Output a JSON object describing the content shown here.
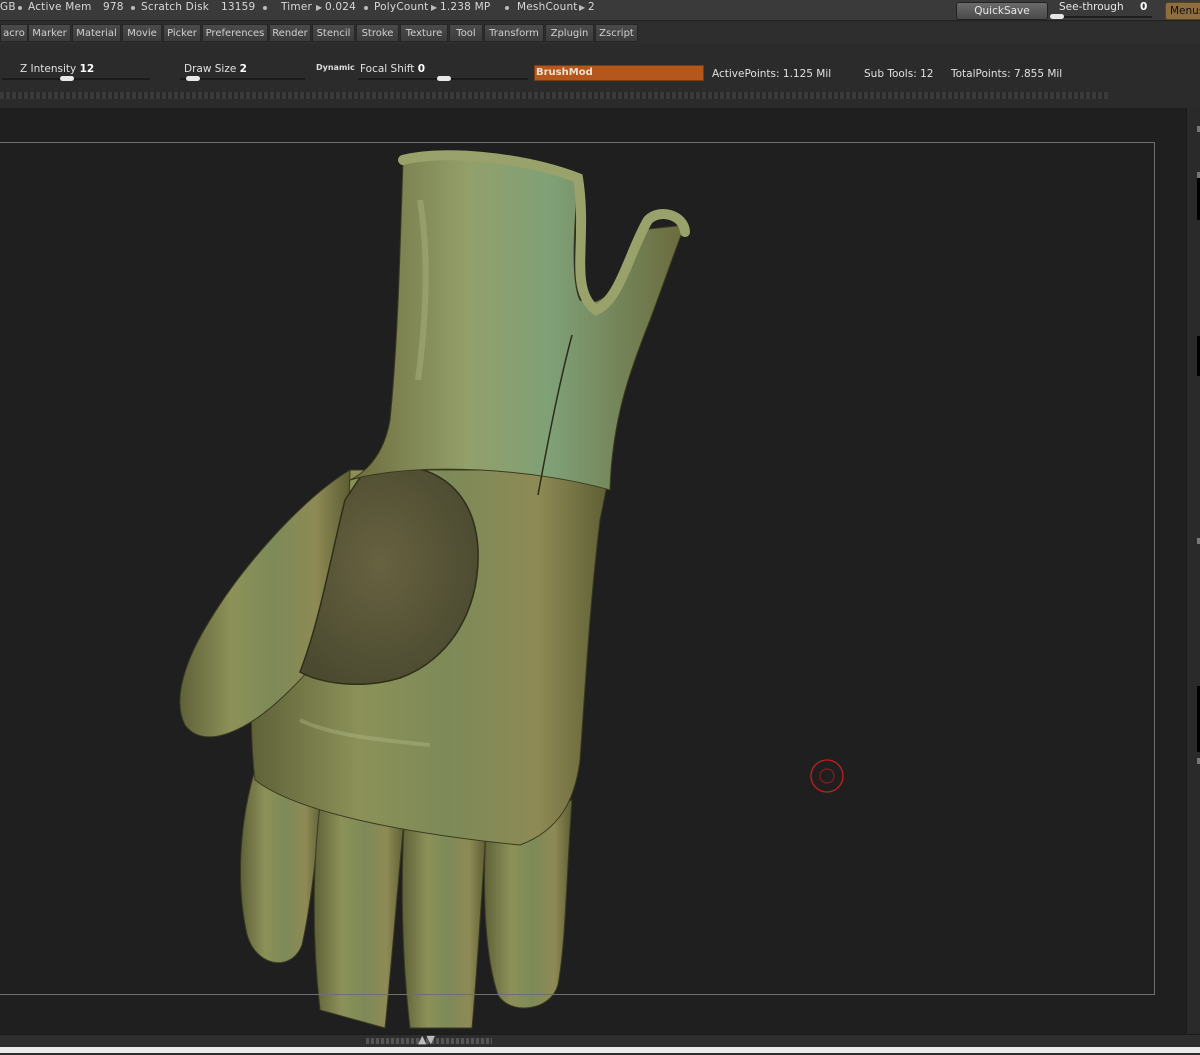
{
  "status_bar": {
    "gb_fragment": "GB",
    "active_mem_label": "Active Mem",
    "active_mem_value": "978",
    "scratch_disk_label": "Scratch Disk",
    "scratch_disk_value": "13159",
    "timer_label": "Timer",
    "timer_value": "0.024",
    "polycount_label": "PolyCount",
    "polycount_value": "1.238 MP",
    "meshcount_label": "MeshCount",
    "meshcount_value": "2",
    "quicksave_label": "QuickSave",
    "see_through_label": "See-through",
    "see_through_value": "0",
    "menus_label": "Menus"
  },
  "menu_bar": {
    "items": [
      "acro",
      "Marker",
      "Material",
      "Movie",
      "Picker",
      "Preferences",
      "Render",
      "Stencil",
      "Stroke",
      "Texture",
      "Tool",
      "Transform",
      "Zplugin",
      "Zscript"
    ]
  },
  "brush_settings": {
    "z_intensity_label": "Z Intensity",
    "z_intensity_value": "12",
    "draw_size_label": "Draw Size",
    "draw_size_value": "2",
    "dynamic_label": "Dynamic",
    "focal_shift_label": "Focal Shift",
    "focal_shift_value": "0",
    "brush_field_text": "BrushMod",
    "active_points": "ActivePoints: 1.125  Mil",
    "sub_tools": "Sub Tools: 12",
    "total_points": "TotalPoints: 7.855  Mil"
  },
  "viewport": {
    "model_icon": "glove-sculpt",
    "cursor_icon": "brush-cursor-ring-icon"
  },
  "colors": {
    "brush_field": "#b5571c",
    "cursor_ring": "#c42020",
    "viewport_bg": "#1f1f1f",
    "model_base": "#8a8a55"
  }
}
